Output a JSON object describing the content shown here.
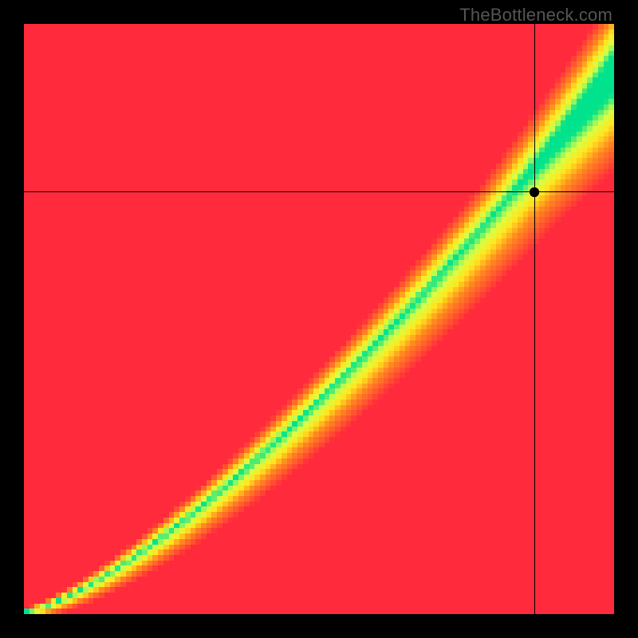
{
  "watermark": "TheBottleneck.com",
  "chart_data": {
    "type": "heatmap",
    "title": "",
    "xlabel": "",
    "ylabel": "",
    "xlim": [
      0,
      100
    ],
    "ylim": [
      0,
      100
    ],
    "grid": false,
    "legend": null,
    "stops": [
      {
        "t": 0.0,
        "hex": "#ff2a3c"
      },
      {
        "t": 0.4,
        "hex": "#ff8a1f"
      },
      {
        "t": 0.62,
        "hex": "#ffe61e"
      },
      {
        "t": 0.8,
        "hex": "#d7ff47"
      },
      {
        "t": 1.0,
        "hex": "#00e28c"
      }
    ],
    "ridge": {
      "exponent": 1.35,
      "y_scale": 0.92,
      "base_half_width": 0.09,
      "min_half_width": 0.012,
      "asymmetry": 0.6
    },
    "corner_boost": {
      "cx": 1.0,
      "cy": 1.0,
      "radius": 0.35,
      "gain": 0.35
    },
    "crosshair": {
      "x": 86.5,
      "y": 71.5
    },
    "marker": {
      "x": 86.5,
      "y": 71.5,
      "radius_px": 6
    },
    "resolution": 110
  }
}
